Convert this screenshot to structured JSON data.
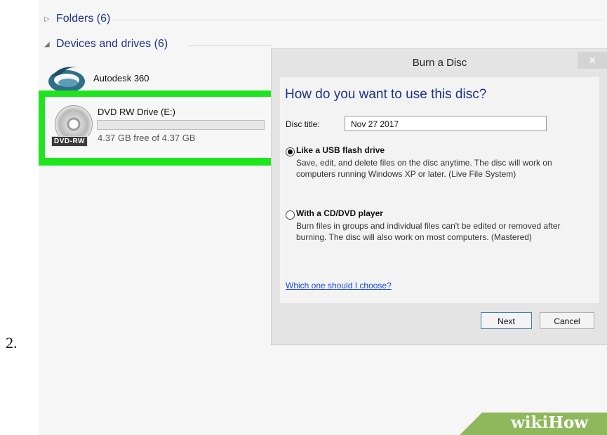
{
  "step_number": "2.",
  "explorer": {
    "folders_header": "Folders (6)",
    "devices_header": "Devices and drives (6)",
    "items": [
      {
        "label": "Autodesk 360",
        "icon": "autodesk-360-icon"
      },
      {
        "label": "DVD RW Drive (E:)",
        "icon": "dvd-drive-icon",
        "badge": "DVD-RW",
        "free_space": "4.37 GB free of 4.37 GB",
        "used_fraction": 0.0,
        "highlight_color": "#1ee51e"
      }
    ]
  },
  "dialog": {
    "title": "Burn a Disc",
    "question": "How do you want to use this disc?",
    "disc_title_label": "Disc title:",
    "disc_title_value": "Nov 27 2017",
    "options": [
      {
        "label": "Like a USB flash drive",
        "description": "Save, edit, and delete files on the disc anytime. The disc will work on computers running Windows XP or later. (Live File System)",
        "selected": true
      },
      {
        "label": "With a CD/DVD player",
        "description": "Burn files in groups and individual files can't be edited or removed after burning. The disc will also work on most computers. (Mastered)",
        "selected": false
      }
    ],
    "help_link": "Which one should I choose?",
    "next_button": "Next",
    "cancel_button": "Cancel",
    "close_icon": "close-icon"
  },
  "watermark": {
    "wiki": "wiki",
    "how": "How"
  },
  "colors": {
    "link": "#1e3287",
    "highlight": "#1ee51e",
    "watermark_band": "#8fb85d"
  }
}
